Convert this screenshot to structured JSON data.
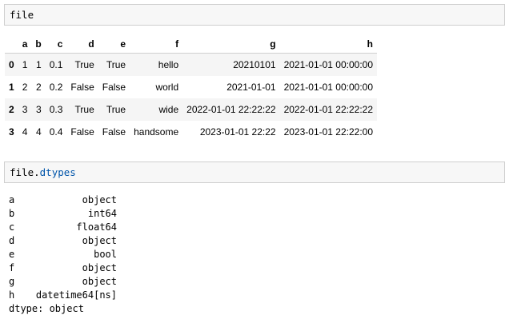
{
  "cell1": {
    "code": "file"
  },
  "table": {
    "columns": [
      "",
      "a",
      "b",
      "c",
      "d",
      "e",
      "f",
      "g",
      "h"
    ],
    "rows": [
      {
        "index": "0",
        "a": "1",
        "b": "1",
        "c": "0.1",
        "d": "True",
        "e": "True",
        "f": "hello",
        "g": "20210101",
        "h": "2021-01-01 00:00:00"
      },
      {
        "index": "1",
        "a": "2",
        "b": "2",
        "c": "0.2",
        "d": "False",
        "e": "False",
        "f": "world",
        "g": "2021-01-01",
        "h": "2021-01-01 00:00:00"
      },
      {
        "index": "2",
        "a": "3",
        "b": "3",
        "c": "0.3",
        "d": "True",
        "e": "True",
        "f": "wide",
        "g": "2022-01-01 22:22:22",
        "h": "2022-01-01 22:22:22"
      },
      {
        "index": "3",
        "a": "4",
        "b": "4",
        "c": "0.4",
        "d": "False",
        "e": "False",
        "f": "handsome",
        "g": "2023-01-01 22:22",
        "h": "2023-01-01 22:22:00"
      }
    ]
  },
  "cell2": {
    "code_object": "file",
    "code_dot": ".",
    "code_attr": "dtypes"
  },
  "dtypes": {
    "entries": [
      {
        "key": "a",
        "value": "object"
      },
      {
        "key": "b",
        "value": "int64"
      },
      {
        "key": "c",
        "value": "float64"
      },
      {
        "key": "d",
        "value": "object"
      },
      {
        "key": "e",
        "value": "bool"
      },
      {
        "key": "f",
        "value": "object"
      },
      {
        "key": "g",
        "value": "object"
      },
      {
        "key": "h",
        "value": "datetime64[ns]"
      }
    ],
    "footer": "dtype: object"
  },
  "colors": {
    "cell_background": "#f7f7f7",
    "cell_border": "#cfcfcf",
    "attr_color": "#0055aa",
    "row_stripe": "#f5f5f5"
  }
}
